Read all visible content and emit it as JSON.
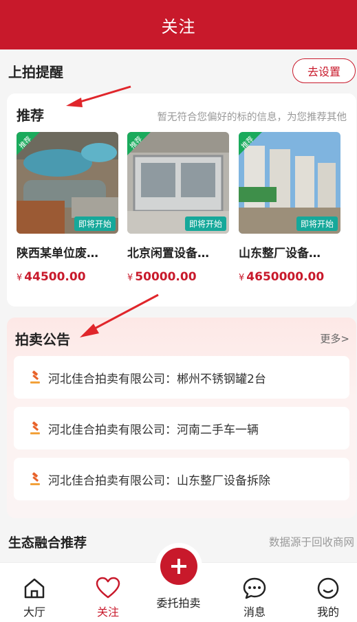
{
  "header": {
    "title": "关注"
  },
  "reminder": {
    "label": "上拍提醒",
    "button": "去设置"
  },
  "recommend": {
    "title": "推荐",
    "hint": "暂无符合您偏好的标的信息，为您推荐其他",
    "items": [
      {
        "corner": "推荐",
        "tag": "即将开始",
        "name": "陕西某单位废…",
        "currency": "¥",
        "price": "44500.00"
      },
      {
        "corner": "推荐",
        "tag": "即将开始",
        "name": "北京闲置设备…",
        "currency": "¥",
        "price": "50000.00"
      },
      {
        "corner": "推荐",
        "tag": "即将开始",
        "name": "山东整厂设备…",
        "currency": "¥",
        "price": "4650000.00"
      }
    ]
  },
  "notice": {
    "title": "拍卖公告",
    "more": "更多>",
    "rows": [
      {
        "text": "河北佳合拍卖有限公司：郴州不锈钢罐2台"
      },
      {
        "text": "河北佳合拍卖有限公司：河南二手车一辆"
      },
      {
        "text": "河北佳合拍卖有限公司：山东整厂设备拆除"
      }
    ]
  },
  "eco": {
    "title": "生态融合推荐",
    "source": "数据源于回收商网"
  },
  "tabbar": {
    "hall": "大厅",
    "follow": "关注",
    "entrust": "委托拍卖",
    "messages": "消息",
    "mine": "我的"
  },
  "colors": {
    "brand": "#c8192b",
    "tag": "#16a89a",
    "corner": "#1aaa5c"
  }
}
